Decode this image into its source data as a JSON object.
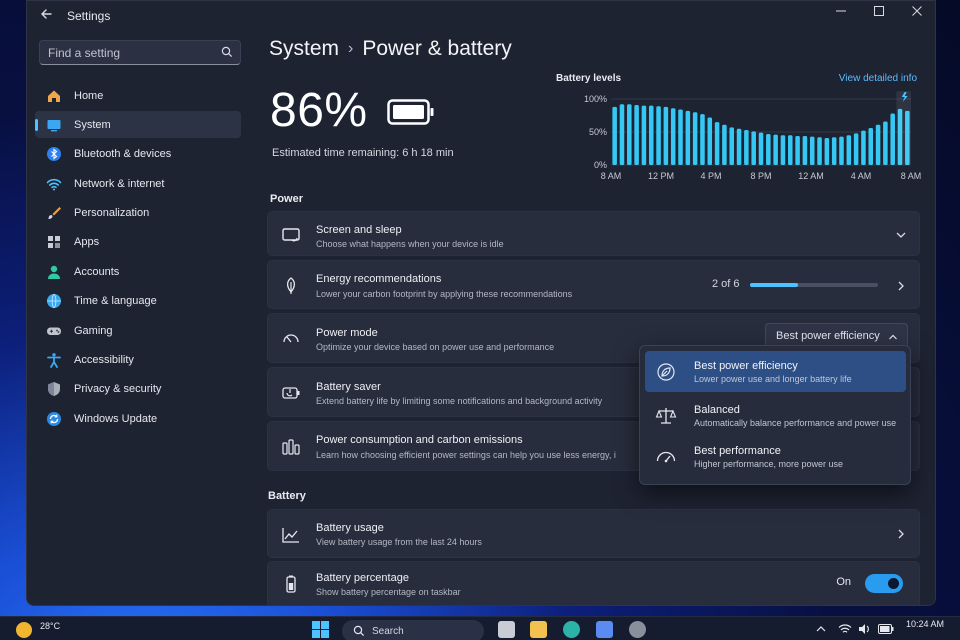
{
  "window": {
    "title": "Settings",
    "back_icon": "back-arrow-icon"
  },
  "search": {
    "placeholder": "Find a setting",
    "value": ""
  },
  "sidebar": {
    "items": [
      {
        "label": "Home",
        "icon": "home-icon",
        "active": false
      },
      {
        "label": "System",
        "icon": "system-icon",
        "active": true
      },
      {
        "label": "Bluetooth & devices",
        "icon": "bluetooth-icon",
        "active": false
      },
      {
        "label": "Network & internet",
        "icon": "wifi-icon",
        "active": false
      },
      {
        "label": "Personalization",
        "icon": "brush-icon",
        "active": false
      },
      {
        "label": "Apps",
        "icon": "apps-icon",
        "active": false
      },
      {
        "label": "Accounts",
        "icon": "person-icon",
        "active": false
      },
      {
        "label": "Time & language",
        "icon": "globe-clock-icon",
        "active": false
      },
      {
        "label": "Gaming",
        "icon": "controller-icon",
        "active": false
      },
      {
        "label": "Accessibility",
        "icon": "accessibility-icon",
        "active": false
      },
      {
        "label": "Privacy & security",
        "icon": "shield-icon",
        "active": false
      },
      {
        "label": "Windows Update",
        "icon": "update-icon",
        "active": false
      }
    ]
  },
  "breadcrumb": {
    "parent": "System",
    "separator": "›",
    "current": "Power & battery"
  },
  "battery": {
    "percent_text": "86%",
    "estimate": "Estimated time remaining: 6 h 18 min"
  },
  "levels_chart": {
    "title": "Battery levels",
    "link": "View detailed info"
  },
  "chart_data": {
    "type": "bar",
    "title": "Battery levels",
    "y_ticks": [
      "100%",
      "50%",
      "0%"
    ],
    "x_ticks": [
      "8 AM",
      "12 PM",
      "4 PM",
      "8 PM",
      "12 AM",
      "4 AM",
      "8 AM"
    ],
    "ylim": [
      0,
      100
    ],
    "values": [
      88,
      92,
      92,
      91,
      90,
      90,
      89,
      88,
      86,
      84,
      82,
      80,
      77,
      72,
      65,
      61,
      57,
      55,
      53,
      51,
      49,
      47,
      46,
      45,
      45,
      44,
      44,
      43,
      42,
      41,
      42,
      43,
      45,
      48,
      52,
      56,
      61,
      66,
      78,
      85,
      82
    ],
    "charging_marker": "lightning-icon",
    "grid": true,
    "bar_color": "#35c8f4"
  },
  "power_section": {
    "label": "Power"
  },
  "screen_sleep": {
    "title": "Screen and sleep",
    "subtitle": "Choose what happens when your device is idle"
  },
  "energy": {
    "title": "Energy recommendations",
    "subtitle": "Lower your carbon footprint by applying these recommendations",
    "progress_text": "2 of 6",
    "progress_fraction": 0.375
  },
  "power_mode": {
    "title": "Power mode",
    "subtitle": "Optimize your device based on power use and performance",
    "selected": "Best power efficiency",
    "options": [
      {
        "title": "Best power efficiency",
        "subtitle": "Lower power use and longer battery life",
        "icon": "leaf-icon",
        "selected": true
      },
      {
        "title": "Balanced",
        "subtitle": "Automatically balance performance and power use",
        "icon": "scales-icon",
        "selected": false
      },
      {
        "title": "Best performance",
        "subtitle": "Higher performance, more power use",
        "icon": "speedometer-icon",
        "selected": false
      }
    ]
  },
  "battery_saver": {
    "title": "Battery saver",
    "subtitle": "Extend battery life by limiting some notifications and background activity"
  },
  "consumption": {
    "title": "Power consumption and carbon emissions",
    "subtitle": "Learn how choosing efficient power settings can help you use less energy, i"
  },
  "battery_section": {
    "label": "Battery"
  },
  "battery_usage": {
    "title": "Battery usage",
    "subtitle": "View battery usage from the last 24 hours"
  },
  "battery_percentage": {
    "title": "Battery percentage",
    "subtitle": "Show battery percentage on taskbar",
    "state_text": "On",
    "enabled": true
  },
  "taskbar": {
    "temp": "28°C",
    "search_label": "Search",
    "time": "10:24 AM",
    "apps": [
      "file-explorer-icon",
      "folder-icon",
      "edge-icon",
      "store-icon",
      "settings-icon"
    ]
  },
  "colors": {
    "accent": "#4cc2ff",
    "window_bg": "#1e2332",
    "card_bg": "#272d3d",
    "selected_option": "#2d4f86"
  }
}
